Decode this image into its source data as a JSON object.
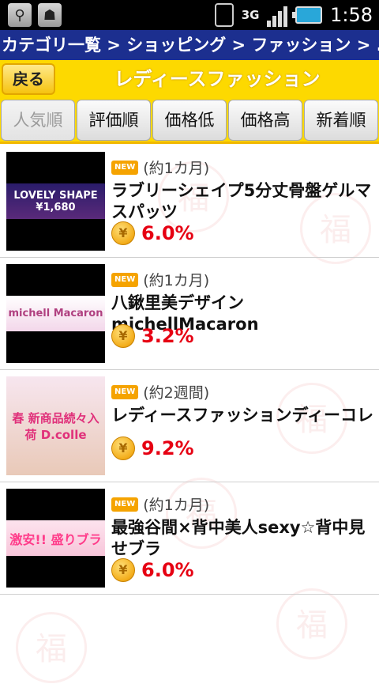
{
  "status_bar": {
    "time": "1:58",
    "network": "3G",
    "icons": [
      "usb-icon",
      "android-debug-icon",
      "sim-icon",
      "network-3g-icon",
      "signal-icon",
      "battery-icon"
    ]
  },
  "breadcrumb": "カテゴリ一覧 > ショッピング > ファッション > ...",
  "header": {
    "back_label": "戻る",
    "title": "レディースファッション"
  },
  "tabs": [
    {
      "label": "人気順",
      "active": true
    },
    {
      "label": "評価順",
      "active": false
    },
    {
      "label": "価格低",
      "active": false
    },
    {
      "label": "価格高",
      "active": false
    },
    {
      "label": "新着順",
      "active": false
    }
  ],
  "items": [
    {
      "badge": "NEW",
      "period": "(約1カ月)",
      "name": "ラブリーシェイプ5分丈骨盤ゲルマスパッツ",
      "rate": "6.0%",
      "thumb_text": "LOVELY SHAPE ¥1,680"
    },
    {
      "badge": "NEW",
      "period": "(約1カ月)",
      "name": "八鍬里美デザインmichellMacaron",
      "rate": "3.2%",
      "thumb_text": "michell Macaron"
    },
    {
      "badge": "NEW",
      "period": "(約2週間)",
      "name": "レディースファッションディーコレ",
      "rate": "9.2%",
      "thumb_text": "春 新商品続々入荷 D.colle"
    },
    {
      "badge": "NEW",
      "period": "(約1カ月)",
      "name": "最強谷間×背中美人sexy☆背中見せブラ",
      "rate": "6.0%",
      "thumb_text": "激安!! 盛りブラ"
    }
  ],
  "colors": {
    "breadcrumb_bg": "#1c2f8f",
    "header_bg": "#fdd900",
    "rate": "#e60012"
  }
}
